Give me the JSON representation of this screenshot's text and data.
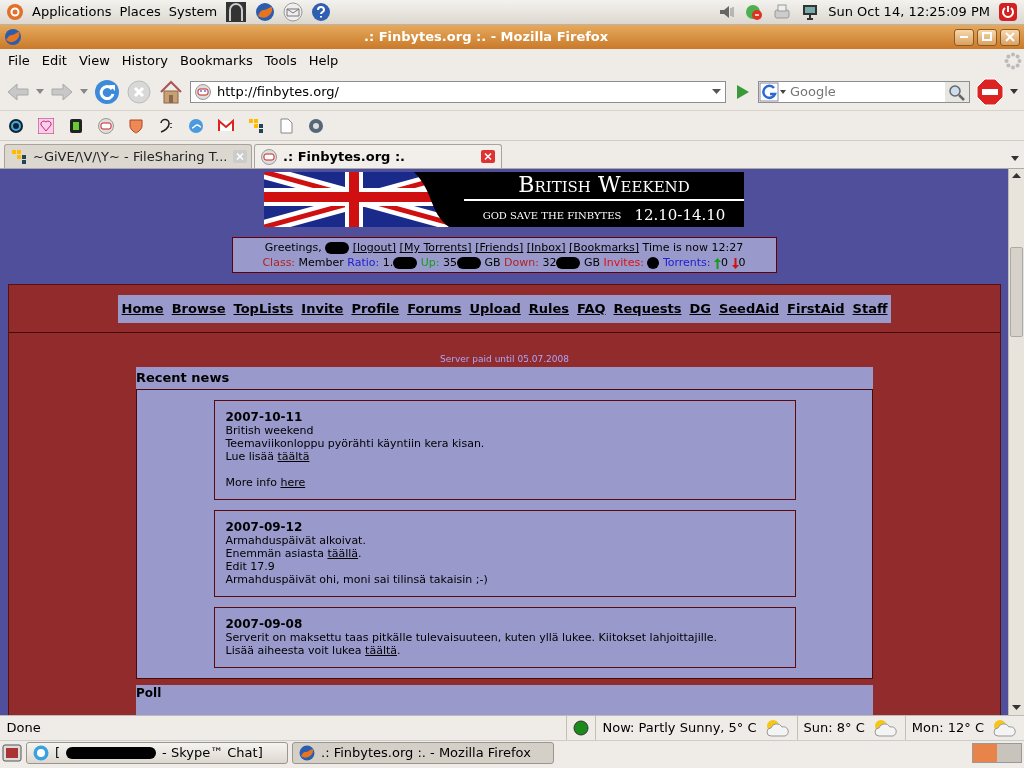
{
  "top_panel": {
    "menus": [
      "Applications",
      "Places",
      "System"
    ],
    "clock": "Sun Oct 14, 12:25:09 PM"
  },
  "window": {
    "title": ".: Finbytes.org :. - Mozilla Firefox"
  },
  "menu_bar": [
    "File",
    "Edit",
    "View",
    "History",
    "Bookmarks",
    "Tools",
    "Help"
  ],
  "address_bar": {
    "url": "http://finbytes.org/"
  },
  "search": {
    "placeholder": "Google"
  },
  "tabs": [
    {
      "label": "~GiVE/\\V/\\Y~ - FileSharing T...",
      "selected": false
    },
    {
      "label": ".: Finbytes.org :.",
      "selected": true
    }
  ],
  "banner": {
    "title": "British Weekend",
    "subtitle": "GOD SAVE THE FINBYTES",
    "dates": "12.10-14.10"
  },
  "user_bar": {
    "greeting": "Greetings,",
    "links": [
      "[logout]",
      "[My Torrents]",
      "[Friends]",
      "[Inbox]",
      "[Bookmarks]"
    ],
    "time": "Time is now 12:27",
    "stats": [
      {
        "label": "Class:",
        "value": "Member",
        "color": "#b22222"
      },
      {
        "label": "Ratio:",
        "value": "1.",
        "color": "#2020d0",
        "redacted": true
      },
      {
        "label": "Up:",
        "value": "35",
        "unit": "GB",
        "color": "#1a9a1a",
        "redacted": true
      },
      {
        "label": "Down:",
        "value": "32",
        "unit": "GB",
        "color": "#b22222",
        "redacted": true
      },
      {
        "label": "Invites:",
        "color": "#e01010",
        "redacted": true
      },
      {
        "label": "Torrents:",
        "color": "#2020d0"
      }
    ],
    "seeding": "0",
    "leeching": "0"
  },
  "nav": [
    "Home",
    "Browse",
    "TopLists",
    "Invite",
    "Profile",
    "Forums",
    "Upload",
    "Rules",
    "FAQ",
    "Requests",
    "DG",
    "SeedAid",
    "FirstAid",
    "Staff"
  ],
  "server_note": "Server paid until 05.07.2008",
  "news": {
    "title": "Recent news",
    "items": [
      {
        "date": "2007-10-11",
        "lines": [
          {
            "text": "British weekend"
          },
          {
            "text": "Teemaviikonloppu pyörähti käyntiin kera kisan."
          },
          {
            "text": "Lue lisää ",
            "link": "täältä"
          },
          {
            "text": "More info ",
            "link": "here",
            "gap_before": true
          }
        ]
      },
      {
        "date": "2007-09-12",
        "lines": [
          {
            "text": "Armahduspäivät alkoivat."
          },
          {
            "text": "Enemmän asiasta ",
            "link": "täällä",
            "tail": "."
          },
          {
            "text": "Edit 17.9"
          },
          {
            "text": "Armahduspäivät ohi, moni sai tilinsä takaisin ;-)"
          }
        ]
      },
      {
        "date": "2007-09-08",
        "lines": [
          {
            "text": "Serverit on maksettu taas pitkälle tulevaisuuteen, kuten yllä lukee. Kiitokset lahjoittajille."
          },
          {
            "text": "Lisää aiheesta voit lukea ",
            "link": "täältä",
            "tail": "."
          }
        ]
      }
    ]
  },
  "poll_title": "Poll",
  "status_bar": {
    "text": "Done",
    "weather": [
      "Now: Partly Sunny, 5° C",
      "Sun: 8° C",
      "Mon: 12° C"
    ]
  },
  "taskbar": [
    {
      "label": "[",
      "tail": "- Skype™ Chat]",
      "redacted": true,
      "selected": false
    },
    {
      "label": ".: Finbytes.org :. - Mozilla Firefox",
      "selected": true
    }
  ]
}
